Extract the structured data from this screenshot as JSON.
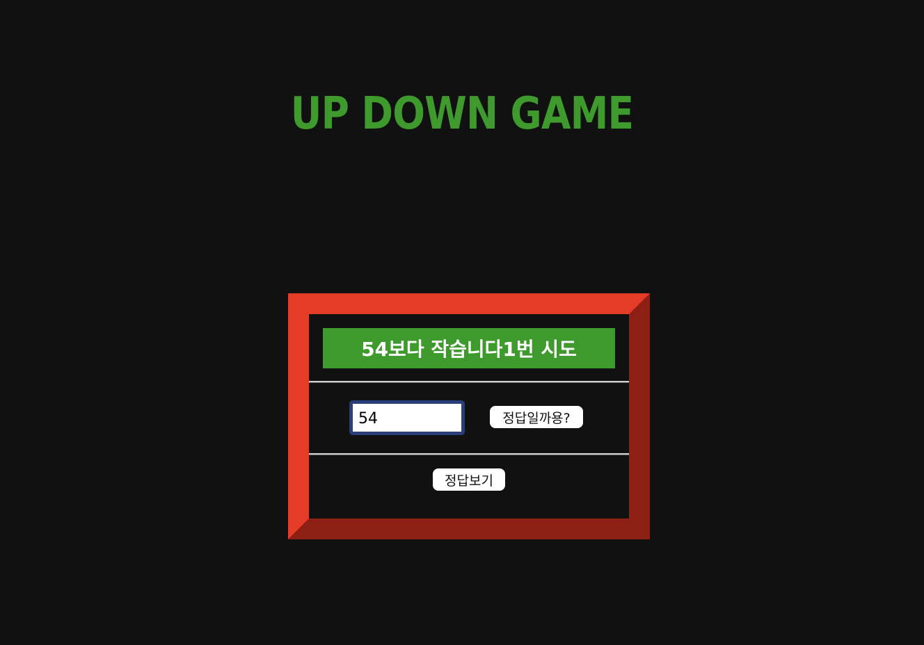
{
  "header": {
    "title": "UP DOWN GAME"
  },
  "game": {
    "result_message": "54보다 작습니다1번 시도",
    "guess_input_value": "54",
    "check_button_label": "정답일까용?",
    "reveal_button_label": "정답보기"
  },
  "colors": {
    "background": "#111111",
    "title_green": "#3f9a2e",
    "banner_green": "#3f9a2e",
    "frame_red_light": "#e53c28",
    "frame_red_dark": "#8e1f14",
    "input_border": "#2a3f7a"
  }
}
